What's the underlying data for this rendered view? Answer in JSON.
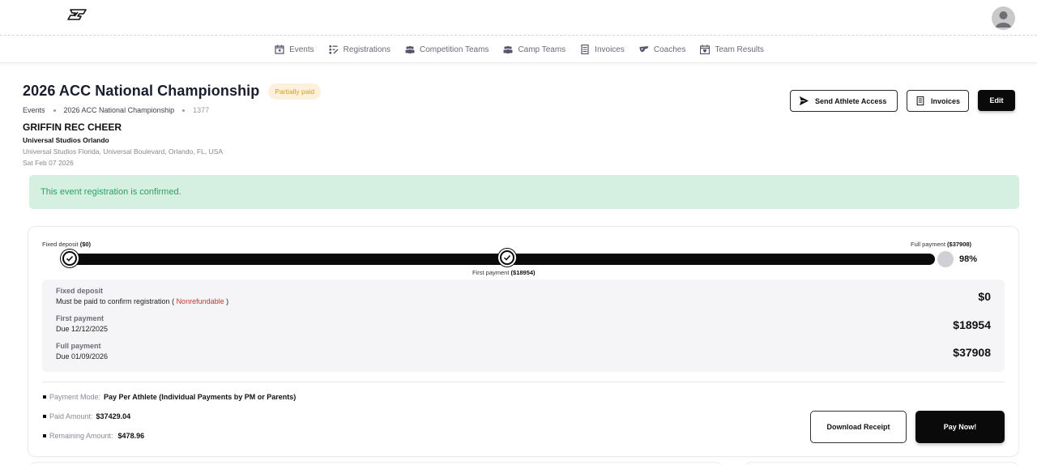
{
  "nav": {
    "items": [
      {
        "label": "Events",
        "icon": "calendar-icon"
      },
      {
        "label": "Registrations",
        "icon": "registrations-icon"
      },
      {
        "label": "Competition Teams",
        "icon": "group-icon"
      },
      {
        "label": "Camp Teams",
        "icon": "group-icon"
      },
      {
        "label": "Invoices",
        "icon": "document-icon"
      },
      {
        "label": "Coaches",
        "icon": "whistle-icon"
      },
      {
        "label": "Team Results",
        "icon": "trophy-calendar-icon"
      }
    ]
  },
  "header": {
    "title": "2026 ACC National Championship",
    "status_badge": "Partially paid",
    "breadcrumb": [
      "Events",
      "2026 ACC National Championship",
      "1377"
    ],
    "team_name": "GRIFFIN REC CHEER",
    "venue_name": "Universal Studios Orlando",
    "venue_address": "Universal Studios Florida, Universal Boulevard, Orlando, FL, USA",
    "date": "Sat Feb 07 2026",
    "buttons": {
      "send_access": "Send Athlete Access",
      "invoices": "Invoices",
      "edit": "Edit"
    }
  },
  "alert": {
    "message": "This event registration is confirmed."
  },
  "progress": {
    "fixed_label": "Fixed deposit",
    "fixed_amount": "($0)",
    "first_label": "First payment",
    "first_amount": "($18954)",
    "full_label": "Full payment",
    "full_amount": "($37908)",
    "percent": "98%",
    "percent_value": 98
  },
  "schedule": [
    {
      "title": "Fixed deposit",
      "subtitle_prefix": "Must be paid to confirm registration ( ",
      "subtitle_highlight": "Nonrefundable",
      "subtitle_suffix": " )",
      "amount": "$0"
    },
    {
      "title": "First payment",
      "subtitle": "Due 12/12/2025",
      "amount": "$18954"
    },
    {
      "title": "Full payment",
      "subtitle": "Due 01/09/2026",
      "amount": "$37908"
    }
  ],
  "details": {
    "payment_mode_label": "Payment Mode:",
    "payment_mode_value": "Pay Per Athlete (Individual Payments by PM or Parents)",
    "paid_label": "Paid Amount:",
    "paid_value": "$37429.04",
    "remaining_label": "Remaining Amount:",
    "remaining_value": "$478.96"
  },
  "actions": {
    "download": "Download Receipt",
    "pay": "Pay Now!"
  },
  "colors": {
    "alert_bg": "#d5efe1",
    "alert_text": "#2e9f63",
    "badge_bg": "#fdf1dc",
    "badge_text": "#d99a25",
    "primary": "#0a0a0a",
    "nonrefundable": "#c0392b"
  }
}
